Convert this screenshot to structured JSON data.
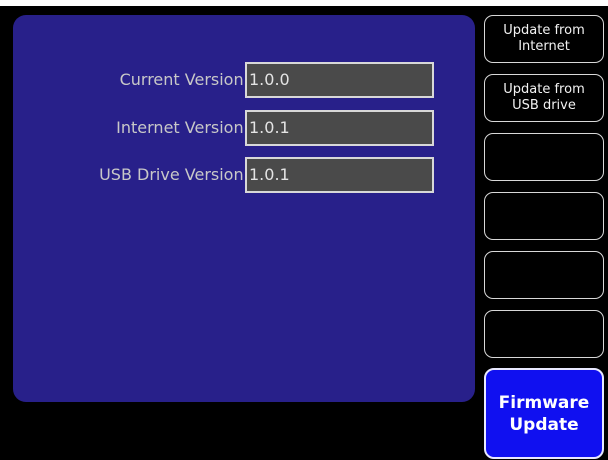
{
  "fields": [
    {
      "label": "Current Version:",
      "value": "1.0.0"
    },
    {
      "label": "Internet Version:",
      "value": "1.0.1"
    },
    {
      "label": "USB Drive Version:",
      "value": "1.0.1"
    }
  ],
  "side_buttons": [
    {
      "label": "Update from\nInternet"
    },
    {
      "label": "Update from\nUSB drive"
    },
    {
      "label": ""
    },
    {
      "label": ""
    },
    {
      "label": ""
    },
    {
      "label": ""
    }
  ],
  "active_button": {
    "label": "Firmware\nUpdate"
  },
  "colors": {
    "panel": "#28208a",
    "background": "#000000",
    "field_fill": "#4a4a4a",
    "active_button": "#1010f0"
  }
}
